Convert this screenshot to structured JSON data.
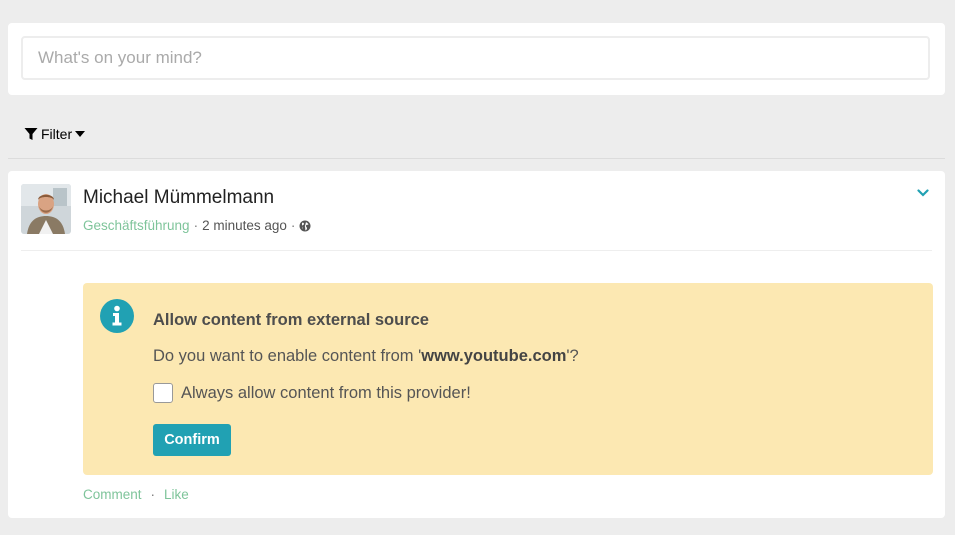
{
  "composer": {
    "placeholder": "What's on your mind?"
  },
  "filter": {
    "label": "Filter",
    "icon": "filter-icon"
  },
  "post": {
    "author": "Michael Mümmelmann",
    "space": "Geschäftsführung",
    "separator": "·",
    "time": "2 minutes ago",
    "visibility_icon": "globe-icon",
    "menu_icon": "chevron-down-icon",
    "consent": {
      "icon": "info-icon",
      "title": "Allow content from external source",
      "question_prefix": "Do you want to enable content from '",
      "domain": "www.youtube.com",
      "question_suffix": "'?",
      "checkbox_label": "Always allow content from this provider!",
      "checkbox_checked": false,
      "confirm_label": "Confirm"
    },
    "actions": {
      "comment": "Comment",
      "separator": "·",
      "like": "Like"
    }
  },
  "colors": {
    "background": "#ededed",
    "accent": "#21a1b3",
    "link_green": "#7ec49a",
    "notice_bg": "#fce8b2"
  }
}
